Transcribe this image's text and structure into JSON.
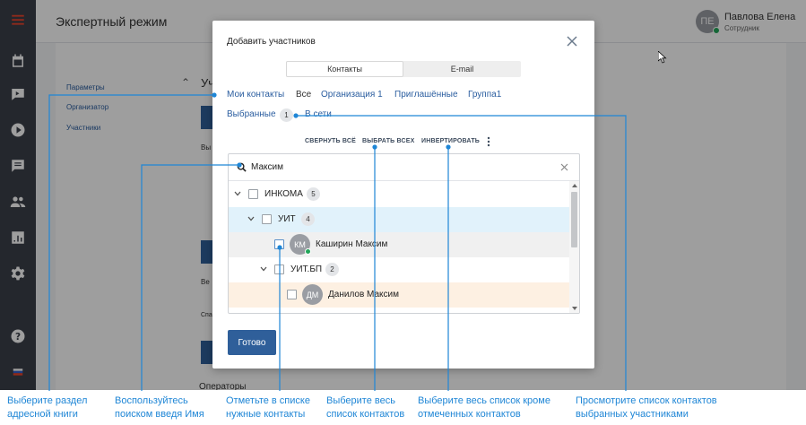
{
  "app": {
    "title": "Экспертный режим",
    "user": {
      "initials": "ПЕ",
      "name": "Павлова Елена",
      "role": "Сотрудник"
    }
  },
  "sidebar": {
    "icons": [
      "menu-icon",
      "calendar-icon",
      "video-icon",
      "play-icon",
      "chat-icon",
      "people-icon",
      "chart-icon",
      "gear-icon",
      "help-icon",
      "flag-icon"
    ]
  },
  "page": {
    "left_nav": [
      "Параметры",
      "Организатор",
      "Участники"
    ],
    "peek_u": "Уч",
    "peek_vy": "Вы",
    "peek_ve": "Ве",
    "peek_spa": "Спа",
    "organizers": "Операторы"
  },
  "modal": {
    "title": "Добавить участников",
    "tabs": [
      "Контакты",
      "E-mail"
    ],
    "filters": [
      "Мои контакты",
      "Все",
      "Организация 1",
      "Приглашённые",
      "Группа1"
    ],
    "selected_label": "Выбранные",
    "selected_count": "1",
    "online_label": "В сети",
    "actions": [
      "СВЕРНУТЬ ВСЁ",
      "ВЫБРАТЬ ВСЕХ",
      "ИНВЕРТИРОВАТЬ"
    ],
    "search_value": "Максим",
    "tree": [
      {
        "name": "ИНКОМА",
        "count": "5"
      },
      {
        "name": "УИТ",
        "count": "4"
      },
      {
        "initials": "КМ",
        "name": "Каширин Максим"
      },
      {
        "name": "УИТ.БП",
        "count": "2"
      },
      {
        "initials": "ДМ",
        "name": "Данилов Максим"
      }
    ],
    "done_label": "Готово"
  },
  "callouts": [
    "Выберите раздел\nадресной книги",
    "Воспользуйтесь\nпоиском введя Имя",
    "Отметьте в списке\nнужные контакты",
    "Выберите весь\nсписок контактов",
    "Выберите весь список кроме\nотмеченных контактов",
    "Просмотрите список контактов\nвыбранных участниками"
  ],
  "colors": {
    "accent": "#2f5f9a",
    "link": "#2a5d9f",
    "callout": "#1f86d6",
    "online": "#22a65a",
    "sidebar": "#3a3f4a"
  }
}
